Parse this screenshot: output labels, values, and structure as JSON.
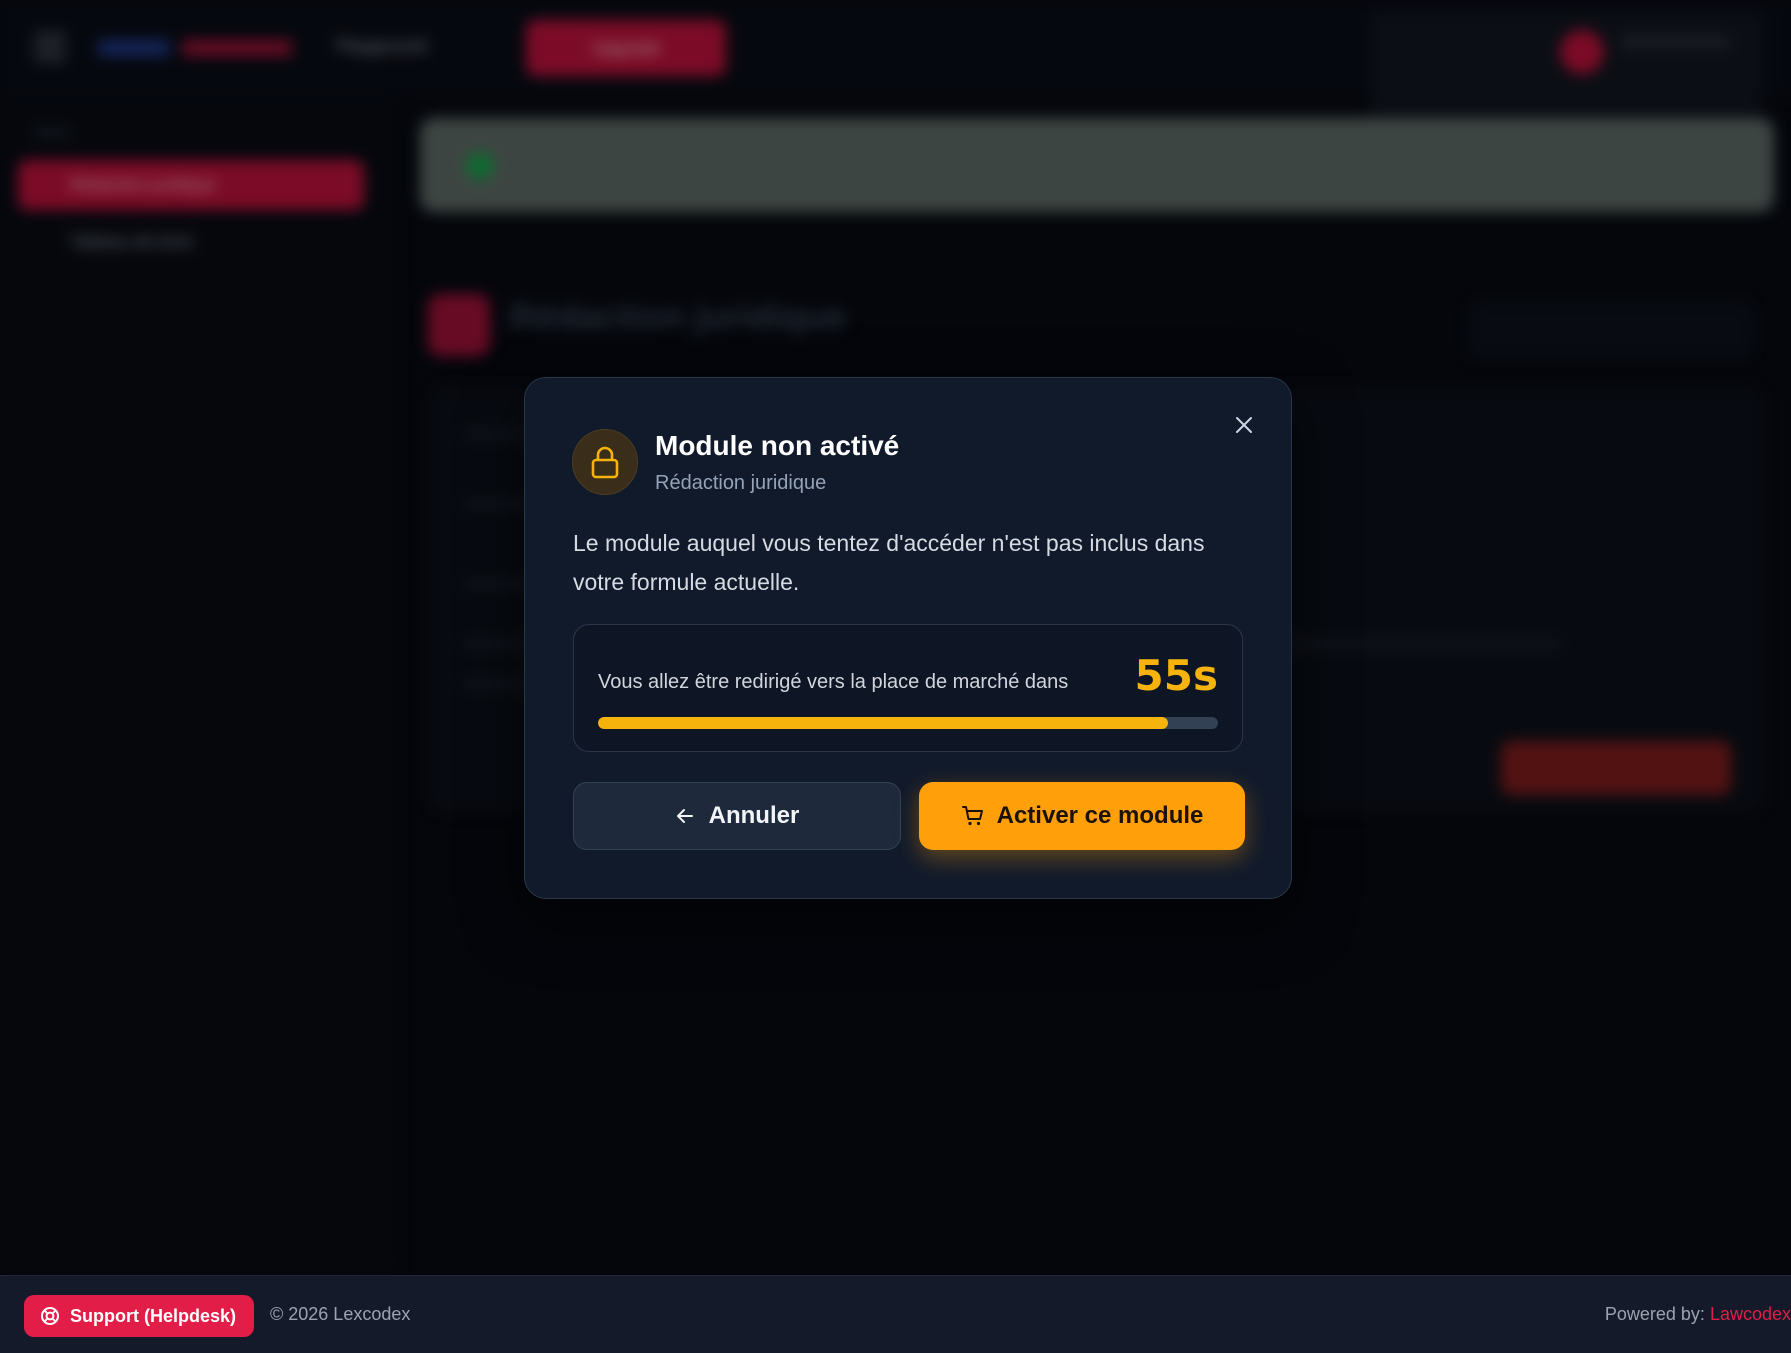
{
  "background": {
    "top_nav_link": "Playground",
    "top_cta": "Upgrade",
    "sidebar_section": "Menu",
    "sidebar_active": "Rédaction juridique",
    "sidebar_item": "Tableau de bord",
    "page_title": "Rédaction juridique"
  },
  "modal": {
    "title": "Module non activé",
    "subtitle": "Rédaction juridique",
    "message": "Le module auquel vous tentez d'accéder n'est pas inclus dans votre formule actuelle.",
    "countdown_label": "Vous allez être redirigé vers la place de marché dans",
    "countdown_value": "55s",
    "progress_fraction": 0.92,
    "cancel_label": "Annuler",
    "activate_label": "Activer ce module",
    "icons": {
      "lock": "lock-icon",
      "close": "close-icon",
      "back": "arrow-left-icon",
      "cart": "cart-icon"
    }
  },
  "footer": {
    "support_label": "Support (Helpdesk)",
    "copyright": "© 2026 Lexcodex",
    "powered_prefix": "Powered by: ",
    "powered_brand": "Lawcodex"
  },
  "colors": {
    "accent_amber": "#f5b30c",
    "activate_orange": "#ff9f0a",
    "brand_red": "#e11d48",
    "modal_bg": "#111a2b"
  }
}
